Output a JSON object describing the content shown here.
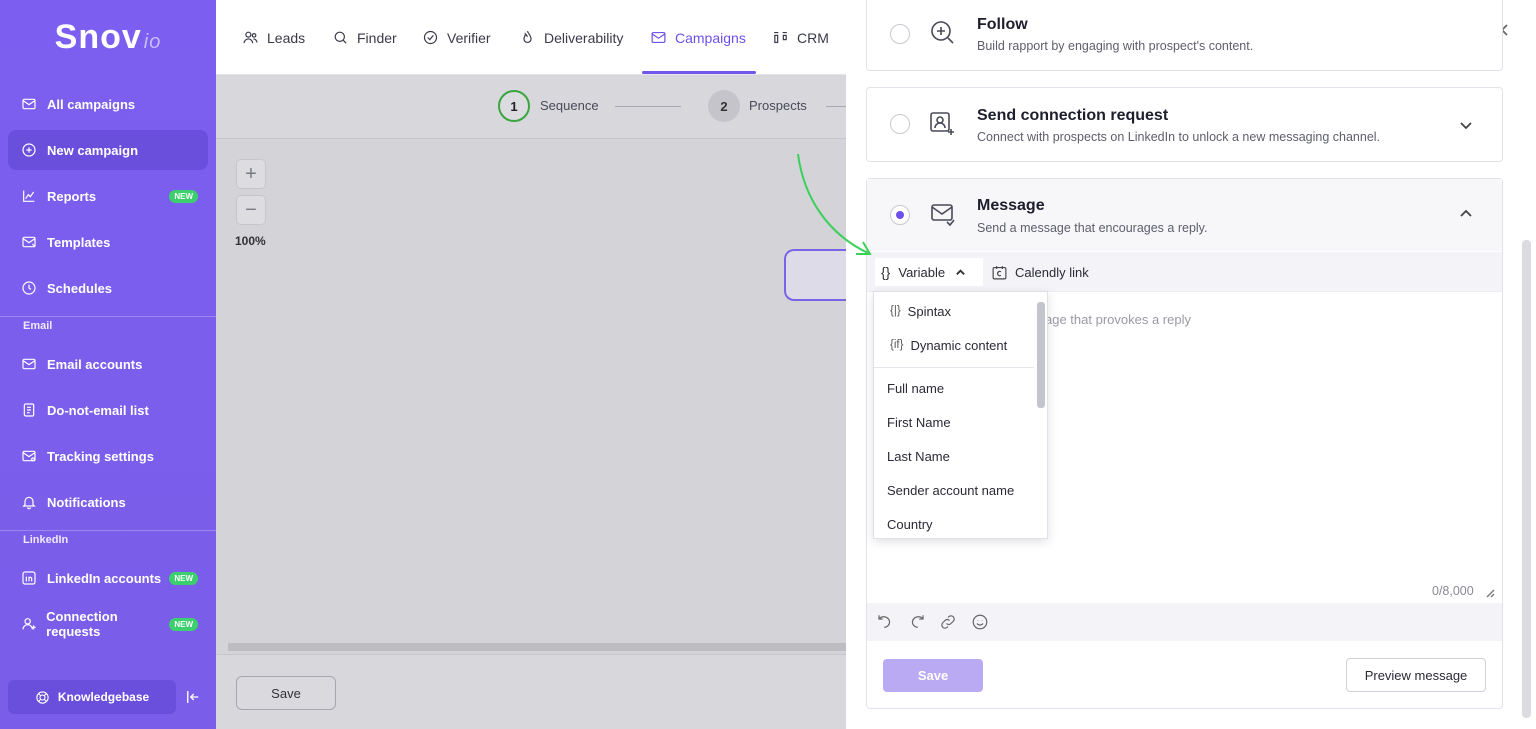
{
  "app": {
    "logo_main": "Snov",
    "logo_sub": "io"
  },
  "sidebar": {
    "items": [
      {
        "label": "All campaigns",
        "icon": "mail-icon"
      },
      {
        "label": "New campaign",
        "icon": "plus-circle-icon",
        "active": true
      },
      {
        "label": "Reports",
        "icon": "chart-icon",
        "badge": "NEW"
      },
      {
        "label": "Templates",
        "icon": "template-icon"
      },
      {
        "label": "Schedules",
        "icon": "clock-icon"
      },
      {
        "label": "Email accounts",
        "icon": "mail-icon"
      },
      {
        "label": "Do-not-email list",
        "icon": "list-icon"
      },
      {
        "label": "Tracking settings",
        "icon": "tracking-icon"
      },
      {
        "label": "Notifications",
        "icon": "bell-icon"
      },
      {
        "label": "LinkedIn accounts",
        "icon": "linkedin-icon",
        "badge": "NEW"
      },
      {
        "label": "Connection requests",
        "icon": "user-plus-icon",
        "badge": "NEW"
      }
    ],
    "section_email": "Email",
    "section_linkedin": "LinkedIn",
    "knowledgebase": "Knowledgebase"
  },
  "topnav": {
    "items": [
      "Leads",
      "Finder",
      "Verifier",
      "Deliverability",
      "Campaigns",
      "CRM"
    ],
    "active": "Campaigns"
  },
  "canvas": {
    "steps": [
      {
        "num": "1",
        "label": "Sequence"
      },
      {
        "num": "2",
        "label": "Prospects"
      }
    ],
    "zoom_in": "+",
    "zoom_out": "−",
    "zoom_level": "100%",
    "save_label": "Save"
  },
  "panel": {
    "follow": {
      "title": "Follow",
      "desc": "Build rapport by engaging with prospect's content."
    },
    "connection": {
      "title": "Send connection request",
      "desc": "Connect with prospects on LinkedIn to unlock a new messaging channel."
    },
    "message": {
      "title": "Message",
      "desc": "Send a message that encourages a reply."
    },
    "toolbar": {
      "variable": "Variable",
      "variable_glyph": "{}",
      "calendly": "Calendly link"
    },
    "placeholder": "age that provokes a reply",
    "counter": "0/8,000",
    "save_label": "Save",
    "preview_label": "Preview message"
  },
  "variable_dropdown": {
    "special": [
      {
        "prefix": "{|}",
        "label": "Spintax"
      },
      {
        "prefix": "{if}",
        "label": "Dynamic content"
      }
    ],
    "fields": [
      "Full name",
      "First Name",
      "Last Name",
      "Sender account name",
      "Country"
    ]
  },
  "colors": {
    "accent": "#6e51e8",
    "sidebar": "#7a5de8",
    "success": "#3ccf6e",
    "annotation_arrow": "#3ad15a"
  }
}
